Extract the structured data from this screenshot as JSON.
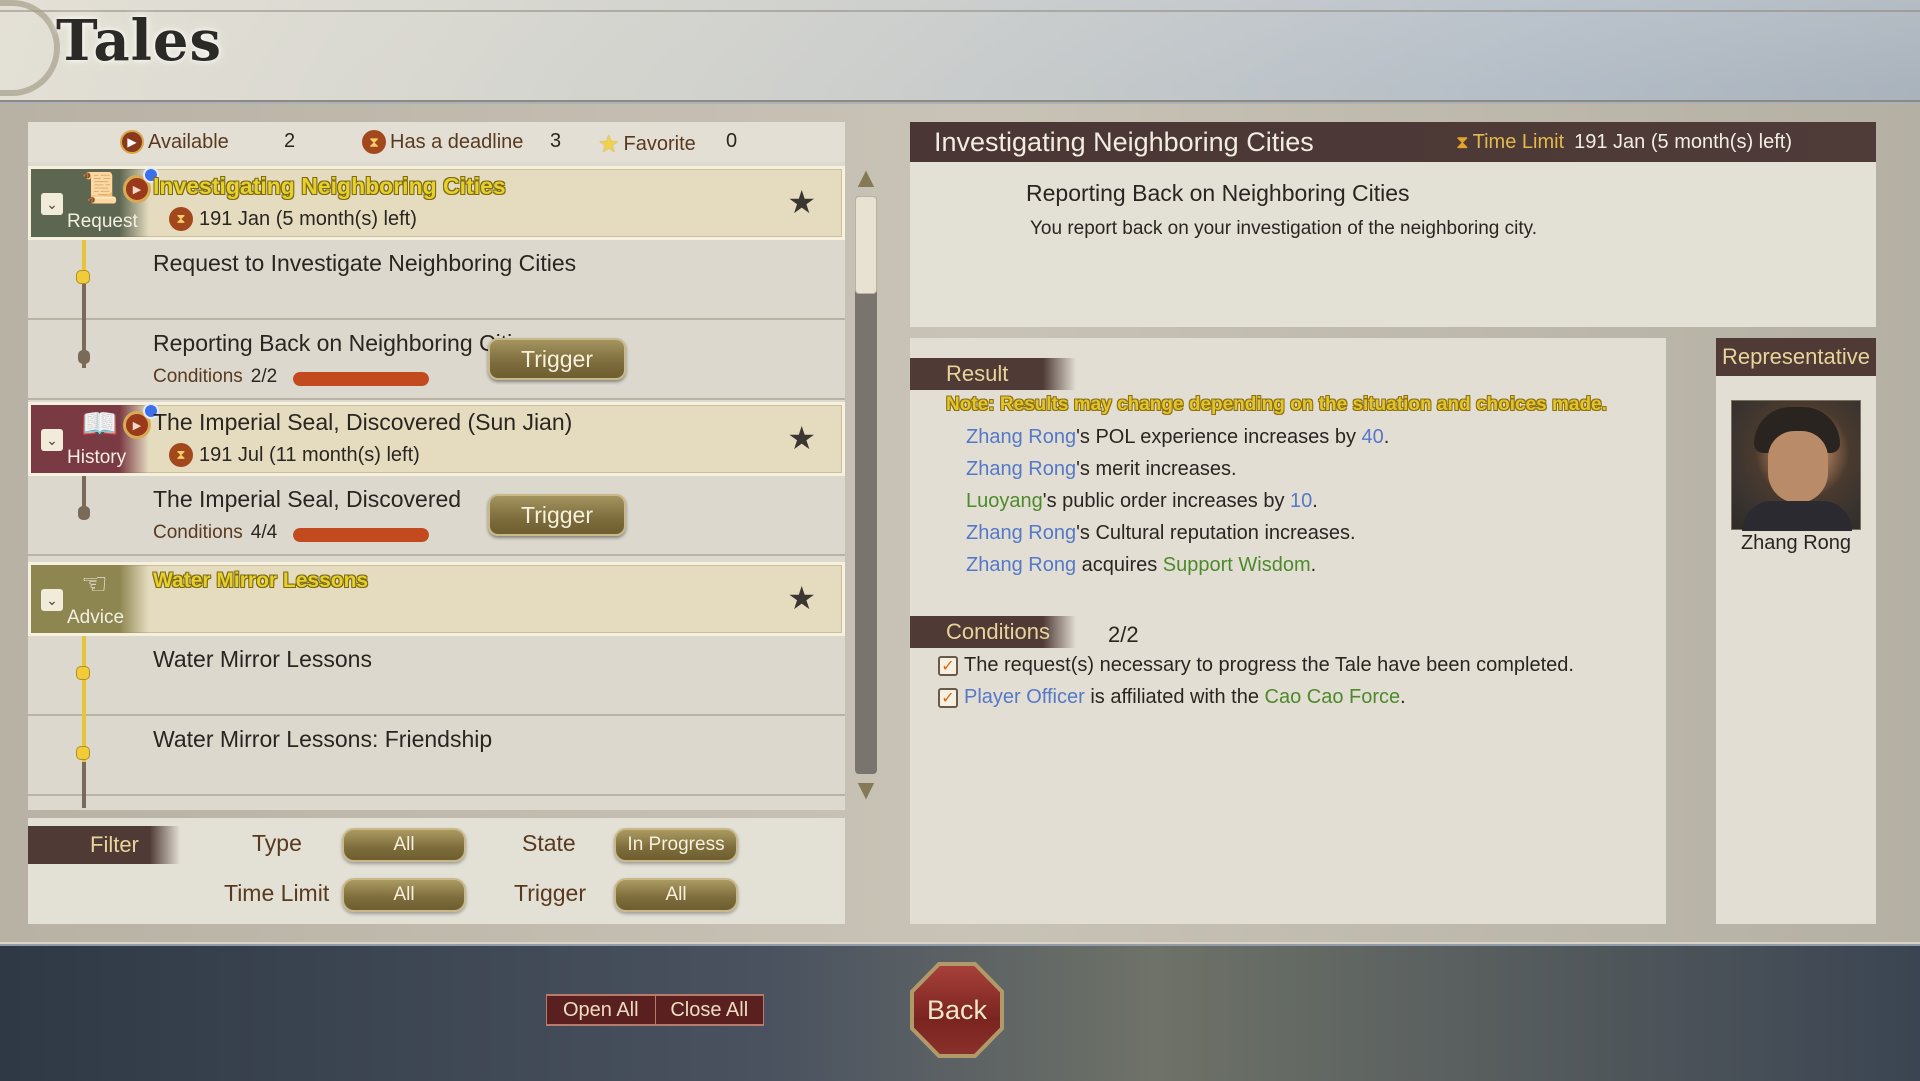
{
  "screen": {
    "title": "Tales"
  },
  "stats": {
    "available": {
      "label": "Available",
      "count": "2",
      "icon": "play-icon"
    },
    "deadline": {
      "label": "Has a deadline",
      "count": "3",
      "icon": "hourglass-icon"
    },
    "favorite": {
      "label": "Favorite",
      "count": "0",
      "icon": "star-icon"
    }
  },
  "tales": [
    {
      "type": "Request",
      "type_icon": "scroll-icon",
      "title": "Investigating Neighboring Cities",
      "highlighted": true,
      "deadline": "191 Jan (5 month(s) left)",
      "favorite_icon": "★",
      "steps": [
        {
          "title": "Request to Investigate Neighboring Cities",
          "status": "completed"
        },
        {
          "title": "Reporting Back on Neighboring Cities",
          "conditions_label": "Conditions",
          "conditions": "2/2",
          "progress": 1.0,
          "trigger_label": "Trigger"
        }
      ]
    },
    {
      "type": "History",
      "type_icon": "book-icon",
      "title": "The Imperial Seal, Discovered (Sun Jian)",
      "highlighted": false,
      "deadline": "191 Jul (11 month(s) left)",
      "favorite_icon": "★",
      "steps": [
        {
          "title": "The Imperial Seal, Discovered",
          "conditions_label": "Conditions",
          "conditions": "4/4",
          "progress": 1.0,
          "trigger_label": "Trigger"
        }
      ]
    },
    {
      "type": "Advice",
      "type_icon": "pointing-hand-icon",
      "title": "Water Mirror Lessons",
      "highlighted": true,
      "favorite_icon": "★",
      "steps": [
        {
          "title": "Water Mirror Lessons",
          "status": "completed"
        },
        {
          "title": "Water Mirror Lessons: Friendship",
          "status": "completed"
        }
      ]
    }
  ],
  "scrollbar": {
    "position": 0.0,
    "visible_fraction": 0.17
  },
  "filter": {
    "label": "Filter",
    "type_label": "Type",
    "type_value": "All",
    "state_label": "State",
    "state_value": "In Progress",
    "time_limit_label": "Time Limit",
    "time_limit_value": "All",
    "trigger_label": "Trigger",
    "trigger_value": "All"
  },
  "detail": {
    "title": "Investigating Neighboring Cities",
    "time_limit_label": "Time Limit",
    "time_limit_value": "191 Jan (5 month(s) left)",
    "subtitle": "Reporting Back on Neighboring Cities",
    "description": "You report back on your investigation of the neighboring city."
  },
  "result": {
    "label": "Result",
    "note": "Note: Results may change depending on the situation and choices made.",
    "lines": [
      {
        "name": "Zhang Rong",
        "mid": "'s POL experience increases by ",
        "value": "40",
        "end": "."
      },
      {
        "name": "Zhang Rong",
        "mid": "'s merit increases.",
        "value": "",
        "end": ""
      },
      {
        "place": "Luoyang",
        "mid": "'s public order increases by ",
        "value": "10",
        "end": "."
      },
      {
        "name": "Zhang Rong",
        "mid": "'s Cultural reputation increases.",
        "value": "",
        "end": ""
      },
      {
        "name": "Zhang Rong",
        "mid": " acquires ",
        "skill": "Support Wisdom",
        "end": "."
      }
    ]
  },
  "conditions": {
    "label": "Conditions",
    "count": "2/2",
    "items": [
      {
        "checked": true,
        "text": "The request(s) necessary to progress the Tale have been completed."
      },
      {
        "checked": true,
        "subject": "Player Officer",
        "mid": " is affiliated with the ",
        "force": "Cao Cao Force",
        "end": "."
      }
    ]
  },
  "representative": {
    "label": "Representative",
    "name": "Zhang Rong"
  },
  "bottom": {
    "open_all": "Open All",
    "close_all": "Close All",
    "back": "Back"
  },
  "colors": {
    "highlight_yellow": "#e7cf2e",
    "name_blue": "#5578c8",
    "place_green": "#4c8a2a",
    "progress_red": "#c24a1e",
    "header_brown": "#4f3a36"
  }
}
